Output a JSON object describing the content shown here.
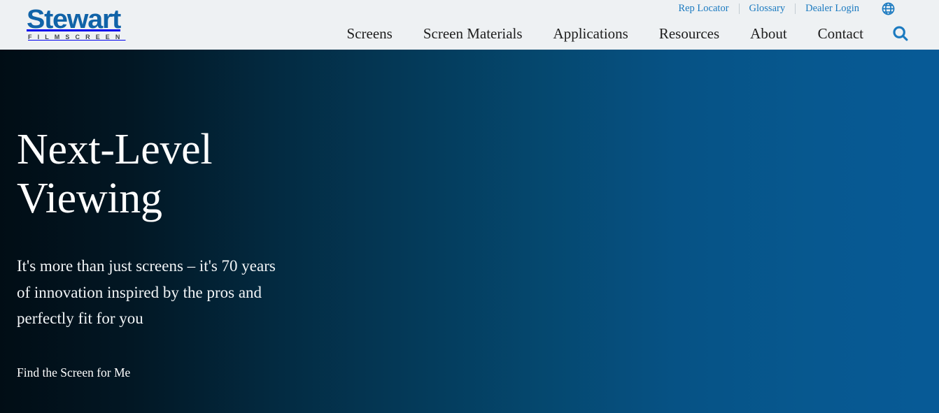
{
  "header": {
    "logo": {
      "word": "Stewart",
      "sub": "FILMSCREEN",
      "word_color": "#1063a8",
      "sub_color": "#3d4348"
    },
    "utility_nav": [
      {
        "label": "Rep Locator"
      },
      {
        "label": "Glossary"
      },
      {
        "label": "Dealer Login"
      }
    ],
    "globe_icon": "globe-icon",
    "search_icon": "search-icon",
    "main_nav": [
      {
        "label": "Screens"
      },
      {
        "label": "Screen Materials"
      },
      {
        "label": "Applications"
      },
      {
        "label": "Resources"
      },
      {
        "label": "About"
      },
      {
        "label": "Contact"
      }
    ],
    "background": "#eef1f3",
    "link_color": "#1b7ac0"
  },
  "hero": {
    "title": "Next-Level Viewing",
    "title_line_1": "Next-Level",
    "title_line_2": "Viewing",
    "subtitle": "It's more than just screens – it's 70 years of innovation inspired by the pros and perfectly fit for you",
    "cta_label": "Find the Screen for Me",
    "gradient_start": "#010d15",
    "gradient_end": "#075a97",
    "text_color": "#ffffff"
  }
}
